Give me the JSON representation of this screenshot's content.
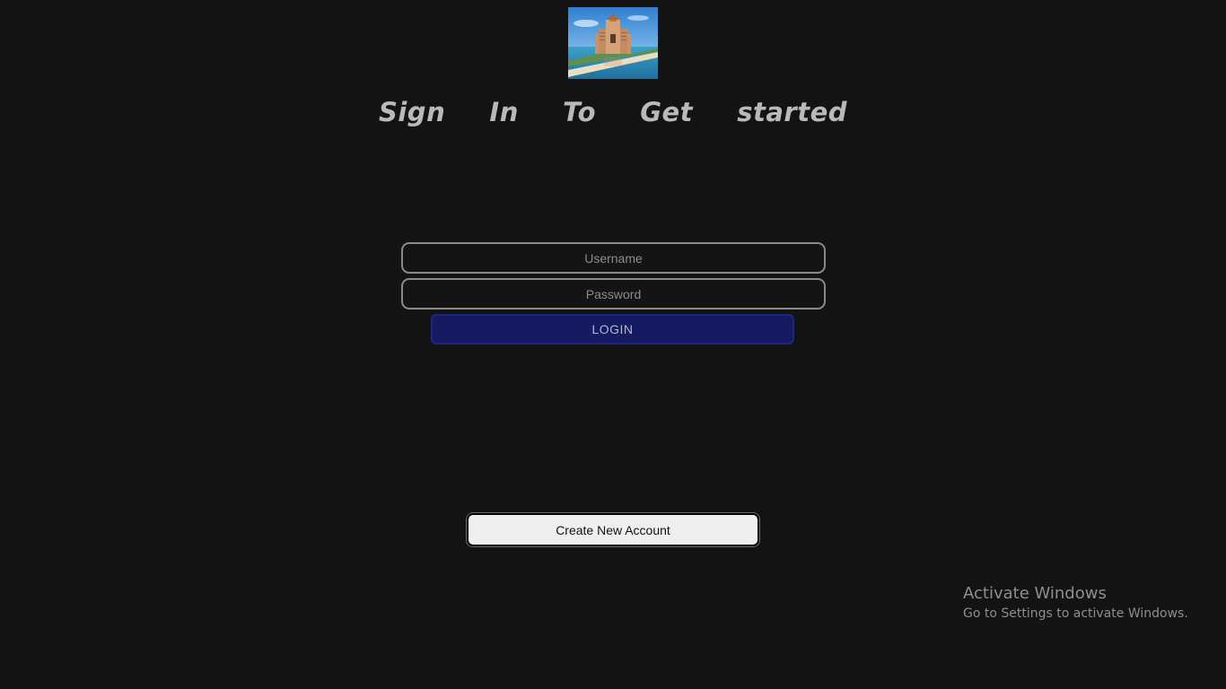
{
  "header": {
    "logo_icon": "resort-hotel-image",
    "title": "Sign  In  To  Get  started"
  },
  "form": {
    "username_placeholder": "Username",
    "username_value": "",
    "password_placeholder": "Password",
    "password_value": "",
    "login_label": "LOGIN"
  },
  "footer": {
    "create_account_label": "Create New Account"
  },
  "os_watermark": {
    "title": "Activate Windows",
    "subtitle": "Go to Settings to activate Windows."
  },
  "colors": {
    "background": "#131313",
    "heading": "#b9b9b9",
    "login_button": "#161a60",
    "create_button": "#efefef"
  }
}
